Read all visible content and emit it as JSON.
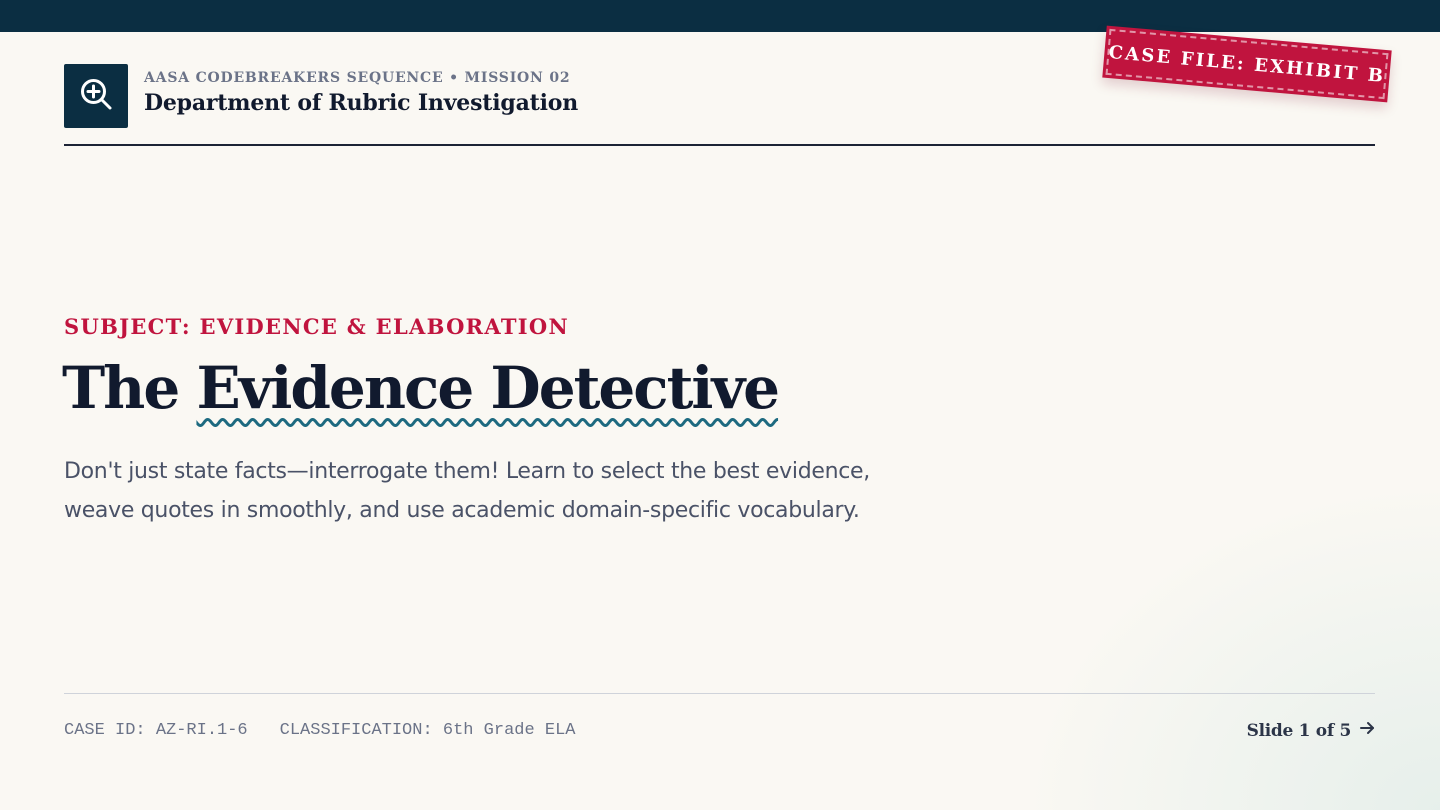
{
  "header": {
    "kicker": "AASA CODEBREAKERS SEQUENCE • MISSION 02",
    "department": "Department of Rubric Investigation",
    "logo_icon": "zoom-in-magnifier-icon"
  },
  "stamp": {
    "label": "CASE FILE: EXHIBIT B"
  },
  "hero": {
    "subject": "SUBJECT: EVIDENCE & ELABORATION",
    "title_prefix": "The",
    "title_highlight": "Evidence Detective",
    "description": "Don't just state facts—interrogate them! Learn to select the best evidence, weave quotes in smoothly, and use academic domain-specific vocabulary."
  },
  "footer": {
    "case_id": "CASE ID: AZ-RI.1-6",
    "classification": "CLASSIFICATION: 6th Grade ELA",
    "slide_label": "Slide 1 of 5",
    "next_icon": "arrow-right-icon"
  },
  "colors": {
    "navy": "#0b2e42",
    "accent_red": "#c0143e",
    "wave_teal": "#1d6a80",
    "background": "#faf8f3"
  }
}
